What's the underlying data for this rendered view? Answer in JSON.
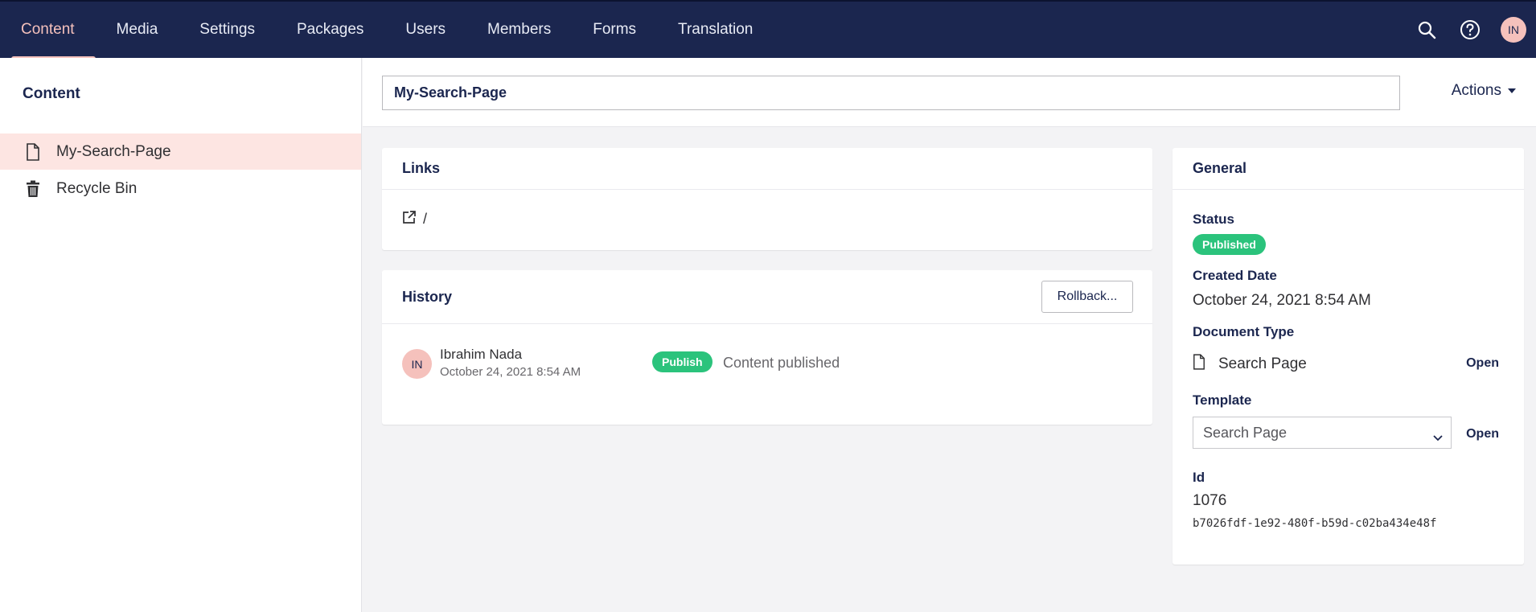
{
  "nav": {
    "items": [
      {
        "label": "Content",
        "active": true
      },
      {
        "label": "Media"
      },
      {
        "label": "Settings"
      },
      {
        "label": "Packages"
      },
      {
        "label": "Users"
      },
      {
        "label": "Members"
      },
      {
        "label": "Forms"
      },
      {
        "label": "Translation"
      }
    ],
    "user_initials": "IN"
  },
  "sidebar": {
    "title": "Content",
    "items": [
      {
        "label": "My-Search-Page",
        "icon": "document-icon",
        "selected": true
      },
      {
        "label": "Recycle Bin",
        "icon": "trash-icon"
      }
    ]
  },
  "editor": {
    "name_value": "My-Search-Page",
    "actions_label": "Actions"
  },
  "links": {
    "title": "Links",
    "url": "/"
  },
  "history": {
    "title": "History",
    "rollback_label": "Rollback...",
    "entries": [
      {
        "initials": "IN",
        "user": "Ibrahim Nada",
        "date": "October 24, 2021 8:54 AM",
        "badge": "Publish",
        "text": "Content published"
      }
    ]
  },
  "general": {
    "title": "General",
    "status_label": "Status",
    "status_value": "Published",
    "created_label": "Created Date",
    "created_value": "October 24, 2021 8:54 AM",
    "doctype_label": "Document Type",
    "doctype_value": "Search Page",
    "open_label": "Open",
    "template_label": "Template",
    "template_value": "Search Page",
    "id_label": "Id",
    "id_value": "1076",
    "guid": "b7026fdf-1e92-480f-b59d-c02ba434e48f"
  },
  "colors": {
    "nav_bg": "#1b264f",
    "accent": "#f5c1bc",
    "success": "#2bc37c"
  }
}
